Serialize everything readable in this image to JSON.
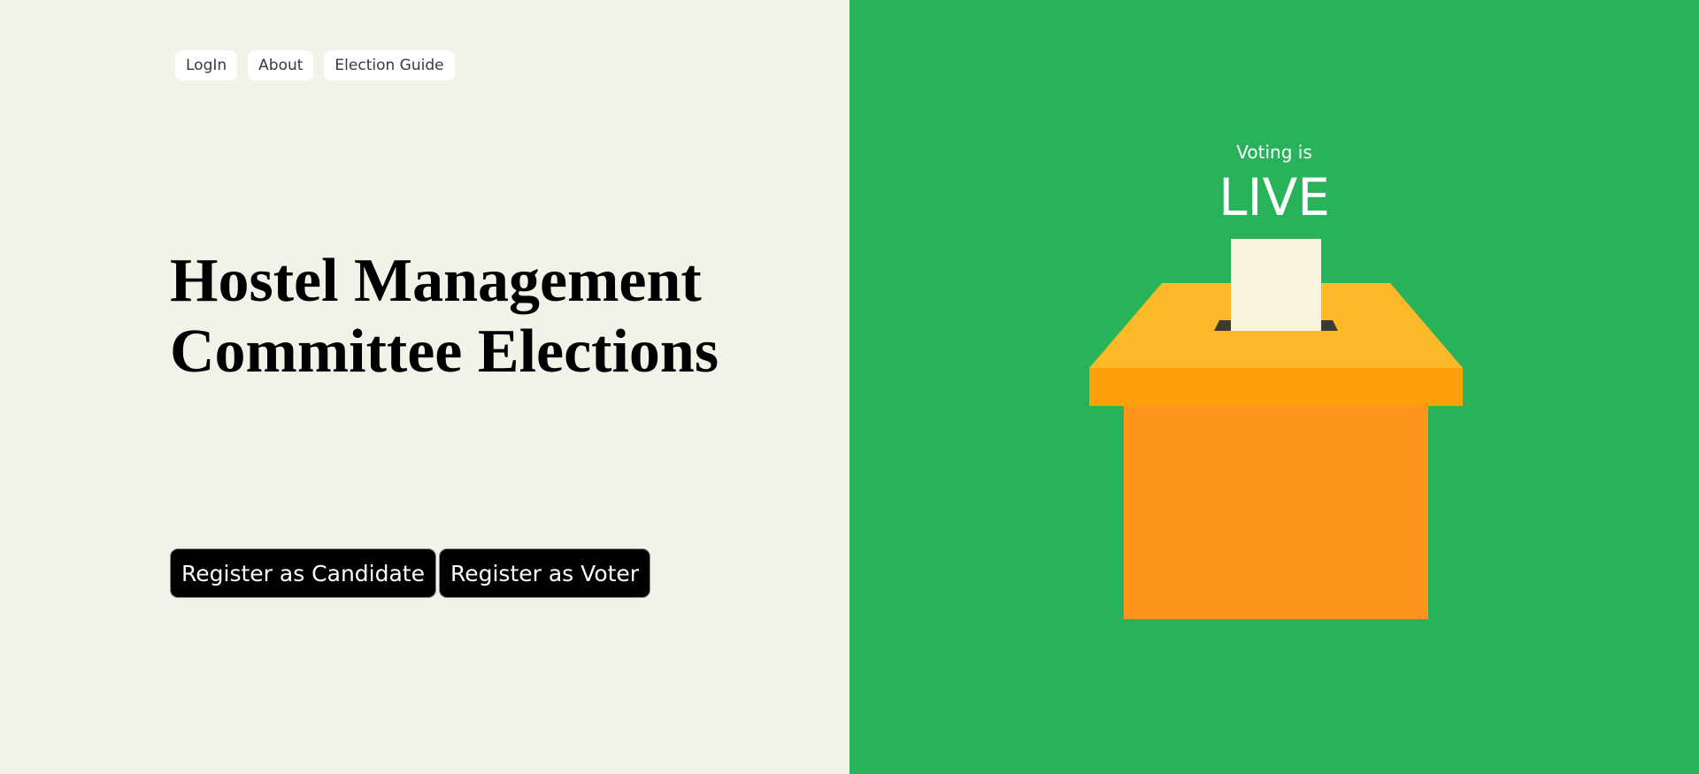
{
  "nav": {
    "items": [
      "LogIn",
      "About",
      "Election Guide"
    ]
  },
  "hero": {
    "title_line1": "Hostel Management",
    "title_line2": "Committee Elections"
  },
  "actions": {
    "candidate_label": "Register as Candidate",
    "voter_label": "Register as Voter"
  },
  "status": {
    "prefix": "Voting is",
    "state": "LIVE"
  },
  "colors": {
    "left_bg": "#f3f2e9",
    "right_bg": "#28b35a",
    "box_lid": "#fdb927",
    "box_band": "#ff9f0a",
    "box_body": "#fe961d",
    "ballot_paper": "#f8f4e0",
    "slot": "#3a3a3a"
  },
  "icons": {
    "illustration": "ballot-box-icon"
  }
}
